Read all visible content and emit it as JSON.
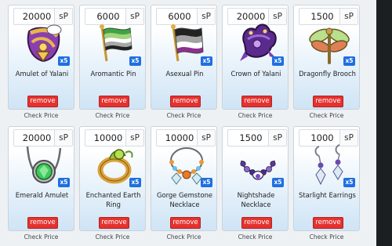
{
  "currency_label": "sP",
  "check_price_label": "Check Price",
  "remove_label": "remove",
  "items": [
    {
      "price": "20000",
      "name": "Amulet of Yalani",
      "qty": "x5",
      "icon": "amulet-icon"
    },
    {
      "price": "6000",
      "name": "Aromantic Pin",
      "qty": "x5",
      "icon": "aromantic-flag-pin-icon"
    },
    {
      "price": "6000",
      "name": "Asexual Pin",
      "qty": "x5",
      "icon": "asexual-flag-pin-icon"
    },
    {
      "price": "20000",
      "name": "Crown of Yalani",
      "qty": "x5",
      "icon": "crown-icon"
    },
    {
      "price": "1500",
      "name": "Dragonfly Brooch",
      "qty": "x5",
      "icon": "dragonfly-brooch-icon"
    },
    {
      "price": "20000",
      "name": "Emerald Amulet",
      "qty": "x5",
      "icon": "emerald-amulet-icon"
    },
    {
      "price": "10000",
      "name": "Enchanted Earth Ring",
      "qty": "x5",
      "icon": "earth-ring-icon"
    },
    {
      "price": "10000",
      "name": "Gorge Gemstone Necklace",
      "qty": "x5",
      "icon": "gemstone-necklace-icon"
    },
    {
      "price": "1500",
      "name": "Nightshade Necklace",
      "qty": "x5",
      "icon": "nightshade-necklace-icon"
    },
    {
      "price": "1000",
      "name": "Starlight Earrings",
      "qty": "x5",
      "icon": "starlight-earrings-icon"
    }
  ],
  "colors": {
    "remove_button": "#e5322f",
    "qty_badge": "#1f6fe0",
    "card_gradient_bottom": "#cfe4f5"
  }
}
